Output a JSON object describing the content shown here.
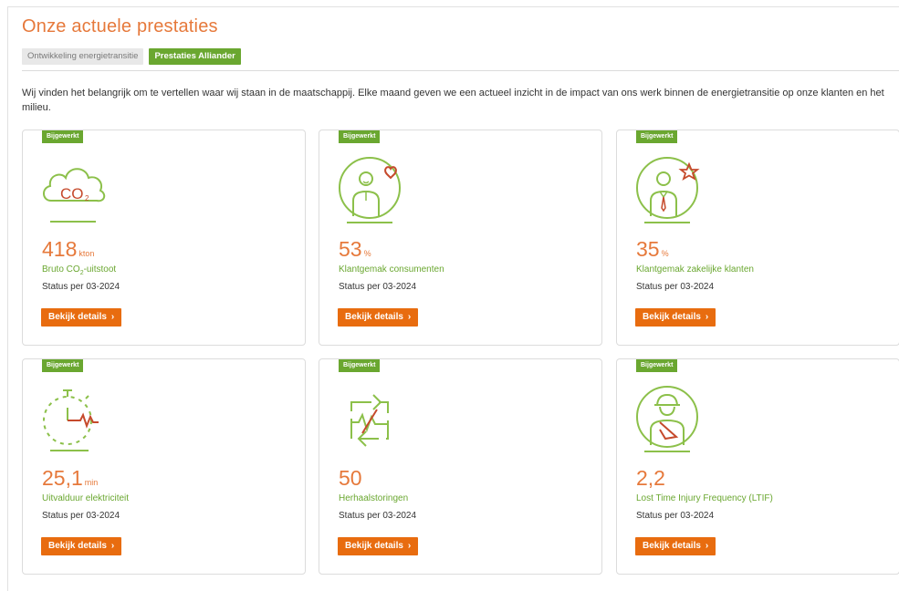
{
  "page": {
    "title": "Onze actuele prestaties",
    "intro": "Wij vinden het belangrijk om te vertellen waar wij staan in de maatschappij. Elke maand geven we een actueel inzicht in de impact van ons werk binnen de energietransitie op onze klanten en het milieu."
  },
  "tabs": [
    {
      "label": "Ontwikkeling energietransitie",
      "active": false
    },
    {
      "label": "Prestaties Alliander",
      "active": true
    }
  ],
  "colors": {
    "accent_orange": "#e6793b",
    "button_orange": "#e86c0f",
    "brand_green": "#6aa730",
    "icon_green": "#8cc04a",
    "icon_red": "#c64a2c"
  },
  "cards": [
    {
      "badge": "Bijgewerkt",
      "icon": "co2-cloud-icon",
      "value": "418",
      "unit": "kton",
      "label_pre": "Bruto CO",
      "label_sub": "2",
      "label_post": "-uitstoot",
      "status": "Status per 03-2024",
      "button": "Bekijk details"
    },
    {
      "badge": "Bijgewerkt",
      "icon": "person-heart-icon",
      "value": "53",
      "unit": "%",
      "label": "Klantgemak consumenten",
      "status": "Status per 03-2024",
      "button": "Bekijk details"
    },
    {
      "badge": "Bijgewerkt",
      "icon": "businessperson-star-icon",
      "value": "35",
      "unit": "%",
      "label": "Klantgemak zakelijke klanten",
      "status": "Status per 03-2024",
      "button": "Bekijk details"
    },
    {
      "badge": "Bijgewerkt",
      "icon": "stopwatch-pulse-icon",
      "value": "25,1",
      "unit": "min",
      "label": "Uitvalduur elektriciteit",
      "status": "Status per 03-2024",
      "button": "Bekijk details"
    },
    {
      "badge": "Bijgewerkt",
      "icon": "repeat-pulse-icon",
      "value": "50",
      "unit": "",
      "label": "Herhaalstoringen",
      "status": "Status per 03-2024",
      "button": "Bekijk details"
    },
    {
      "badge": "Bijgewerkt",
      "icon": "injured-worker-icon",
      "value": "2,2",
      "unit": "",
      "label": "Lost Time Injury Frequency (LTIF)",
      "status": "Status per 03-2024",
      "button": "Bekijk details"
    }
  ]
}
